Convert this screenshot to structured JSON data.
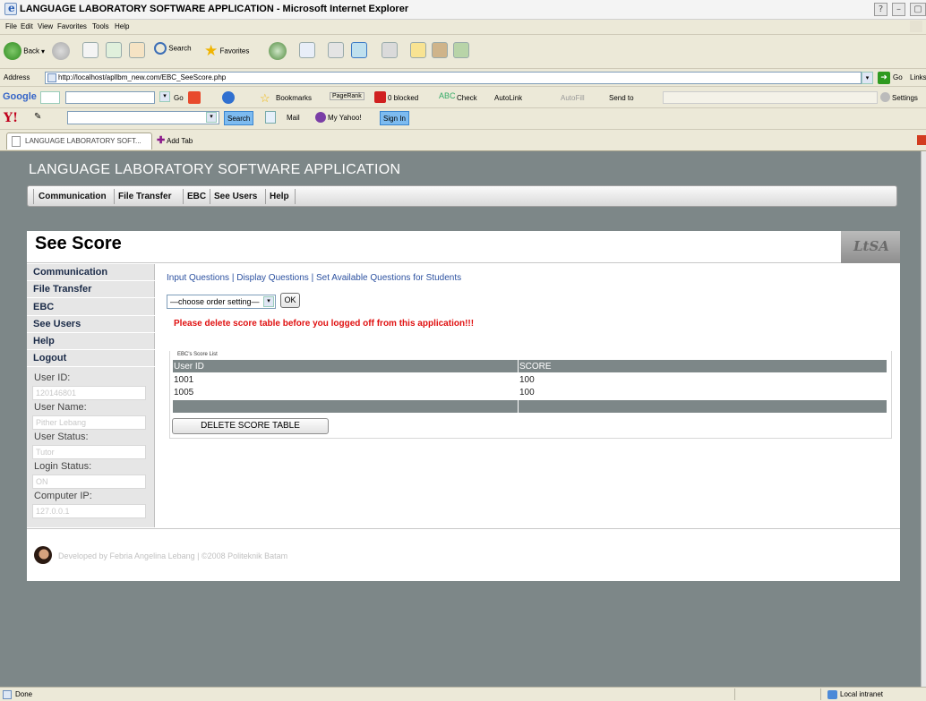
{
  "window": {
    "title": "LANGUAGE LABORATORY SOFTWARE APPLICATION - Microsoft Internet Explorer"
  },
  "menu": [
    "File",
    "Edit",
    "View",
    "Favorites",
    "Tools",
    "Help"
  ],
  "toolbar": {
    "back": "Back",
    "search": "Search",
    "favorites": "Favorites"
  },
  "address": {
    "label": "Address",
    "url": "http://localhost/apllbm_new.com/EBC_SeeScore.php",
    "go": "Go",
    "links": "Links"
  },
  "googlebar": {
    "brand": "Google",
    "go": "Go",
    "bookmarks": "Bookmarks",
    "pagerank": "PageRank",
    "blocked": "0 blocked",
    "check": "Check",
    "autolink": "AutoLink",
    "autofill": "AutoFill",
    "sendto": "Send to",
    "settings": "Settings"
  },
  "yahoobar": {
    "search": "Search",
    "mail": "Mail",
    "my_yahoo": "My Yahoo!",
    "sign_in": "Sign In"
  },
  "tabs": {
    "active": "LANGUAGE LABORATORY SOFT...",
    "add": "Add Tab"
  },
  "app": {
    "title": "LANGUAGE LABORATORY SOFTWARE APPLICATION",
    "nav": [
      "Communication",
      "File Transfer",
      "EBC",
      "See Users",
      "Help"
    ],
    "logo_text": "LtSA"
  },
  "page": {
    "title": "See Score",
    "sidebar": [
      "Communication",
      "File Transfer",
      "EBC",
      "See Users",
      "Help",
      "Logout"
    ],
    "user_fields": [
      {
        "label": "User ID:",
        "value": "120146801"
      },
      {
        "label": "User Name:",
        "value": "Pither Lebang"
      },
      {
        "label": "User Status:",
        "value": "Tutor"
      },
      {
        "label": "Login Status:",
        "value": "ON"
      },
      {
        "label": "Computer IP:",
        "value": "127.0.0.1"
      }
    ],
    "links": [
      "Input Questions",
      "Display Questions",
      "Set Available Questions for Students"
    ],
    "link_separator": "|",
    "order_select": "—choose order setting—",
    "ok": "OK",
    "warning": "Please delete score table before you logged off from this application!!!",
    "score_caption": "EBC's Score List",
    "table": {
      "headers": [
        "User ID",
        "SCORE"
      ],
      "rows": [
        [
          "1001",
          "100"
        ],
        [
          "1005",
          "100"
        ]
      ]
    },
    "delete_button": "DELETE SCORE TABLE",
    "footer": "Developed by Febria Angelina Lebang | ©2008 Politeknik Batam"
  },
  "status": {
    "left": "Done",
    "zone": "Local intranet"
  }
}
